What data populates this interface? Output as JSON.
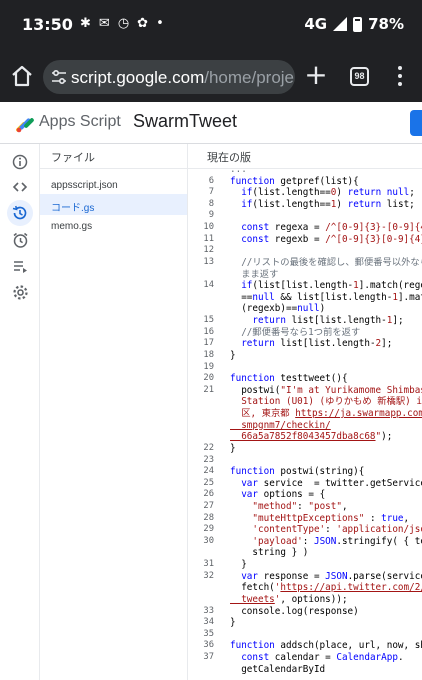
{
  "status_bar": {
    "time": "13:50",
    "network": "4G",
    "battery": "78%"
  },
  "browser": {
    "url_host": "script.google.com",
    "url_path": "/home/proje",
    "tab_count": "98"
  },
  "header": {
    "app_name": "Apps Script",
    "project_name": "SwarmTweet"
  },
  "rail_icons": [
    "info-icon",
    "code-icon",
    "history-icon",
    "clock-icon",
    "executions-icon",
    "settings-icon"
  ],
  "files_panel": {
    "title": "ファイル",
    "files": [
      "appsscript.json",
      "コード.gs",
      "memo.gs"
    ],
    "selected_index": 1
  },
  "editor": {
    "title": "現在の版",
    "lines": [
      {
        "n": "",
        "t": [
          [
            "c",
            "..."
          ]
        ]
      },
      {
        "n": "6",
        "t": [
          [
            "k",
            "function"
          ],
          [
            "v",
            " getpref(list){"
          ]
        ]
      },
      {
        "n": "7",
        "t": [
          [
            "v",
            "  "
          ],
          [
            "k",
            "if"
          ],
          [
            "v",
            "(list.length=="
          ],
          [
            "s",
            "0"
          ],
          [
            "v",
            ") "
          ],
          [
            "k",
            "return"
          ],
          [
            "v",
            " "
          ],
          [
            "k",
            "null"
          ],
          [
            "v",
            ";"
          ]
        ]
      },
      {
        "n": "8",
        "t": [
          [
            "v",
            "  "
          ],
          [
            "k",
            "if"
          ],
          [
            "v",
            "(list.length=="
          ],
          [
            "s",
            "1"
          ],
          [
            "v",
            ") "
          ],
          [
            "k",
            "return"
          ],
          [
            "v",
            " list;"
          ]
        ]
      },
      {
        "n": "9",
        "t": []
      },
      {
        "n": "10",
        "t": [
          [
            "v",
            "  "
          ],
          [
            "k",
            "const"
          ],
          [
            "v",
            " regexa = "
          ],
          [
            "s",
            "/^[0-9]{3}-[0-9]{4}$/"
          ]
        ]
      },
      {
        "n": "11",
        "t": [
          [
            "v",
            "  "
          ],
          [
            "k",
            "const"
          ],
          [
            "v",
            " regexb = "
          ],
          [
            "s",
            "/^[0-9]{3}[0-9]{4}$/;"
          ]
        ]
      },
      {
        "n": "12",
        "t": []
      },
      {
        "n": "13",
        "t": [
          [
            "c",
            "  //リストの最後を確認し、郵便番号以外ならその"
          ]
        ]
      },
      {
        "n": "",
        "t": [
          [
            "c",
            "  まま返す"
          ]
        ]
      },
      {
        "n": "14",
        "t": [
          [
            "v",
            "  "
          ],
          [
            "k",
            "if"
          ],
          [
            "v",
            "(list[list.length-"
          ],
          [
            "s",
            "1"
          ],
          [
            "v",
            "].match(regexa)"
          ]
        ]
      },
      {
        "n": "",
        "t": [
          [
            "v",
            "  =="
          ],
          [
            "k",
            "null"
          ],
          [
            "v",
            " && list[list.length-"
          ],
          [
            "s",
            "1"
          ],
          [
            "v",
            "].match"
          ]
        ]
      },
      {
        "n": "",
        "t": [
          [
            "v",
            "  (regexb)=="
          ],
          [
            "k",
            "null"
          ],
          [
            "v",
            ")"
          ]
        ]
      },
      {
        "n": "15",
        "t": [
          [
            "v",
            "    "
          ],
          [
            "k",
            "return"
          ],
          [
            "v",
            " list[list.length-"
          ],
          [
            "s",
            "1"
          ],
          [
            "v",
            "];"
          ]
        ]
      },
      {
        "n": "16",
        "t": [
          [
            "c",
            "  //郵便番号なら1つ前を返す"
          ]
        ]
      },
      {
        "n": "17",
        "t": [
          [
            "v",
            "  "
          ],
          [
            "k",
            "return"
          ],
          [
            "v",
            " list[list.length-"
          ],
          [
            "s",
            "2"
          ],
          [
            "v",
            "];"
          ]
        ]
      },
      {
        "n": "18",
        "t": [
          [
            "v",
            "}"
          ]
        ]
      },
      {
        "n": "19",
        "t": []
      },
      {
        "n": "20",
        "t": [
          [
            "k",
            "function"
          ],
          [
            "v",
            " testtweet(){"
          ]
        ]
      },
      {
        "n": "21",
        "t": [
          [
            "v",
            "  postwi("
          ],
          [
            "s",
            "\"I'm at Yurikamome Shimbashi"
          ]
        ]
      },
      {
        "n": "",
        "t": [
          [
            "s",
            "  Station (U01) (ゆりかもめ 新橋駅) in 港"
          ]
        ]
      },
      {
        "n": "",
        "t": [
          [
            "s",
            "  区, 東京都 "
          ],
          [
            "u",
            "https://ja.swarmapp.com/"
          ]
        ]
      },
      {
        "n": "",
        "t": [
          [
            "u",
            "  smpgnm7/checkin/"
          ]
        ]
      },
      {
        "n": "",
        "t": [
          [
            "u",
            "  66a5a7852f8043457dba8c68"
          ],
          [
            "s",
            "\""
          ],
          [
            "v",
            ");"
          ]
        ]
      },
      {
        "n": "22",
        "t": [
          [
            "v",
            "}"
          ]
        ]
      },
      {
        "n": "23",
        "t": []
      },
      {
        "n": "24",
        "t": [
          [
            "k",
            "function"
          ],
          [
            "v",
            " postwi(string){"
          ]
        ]
      },
      {
        "n": "25",
        "t": [
          [
            "v",
            "  "
          ],
          [
            "k",
            "var"
          ],
          [
            "v",
            " service  = twitter.getService();"
          ]
        ]
      },
      {
        "n": "26",
        "t": [
          [
            "v",
            "  "
          ],
          [
            "k",
            "var"
          ],
          [
            "v",
            " options = {"
          ]
        ]
      },
      {
        "n": "27",
        "t": [
          [
            "v",
            "    "
          ],
          [
            "s",
            "\"method\""
          ],
          [
            "v",
            ": "
          ],
          [
            "s",
            "\"post\""
          ],
          [
            "v",
            ","
          ]
        ]
      },
      {
        "n": "28",
        "t": [
          [
            "v",
            "    "
          ],
          [
            "s",
            "\"muteHttpExceptions\""
          ],
          [
            "v",
            " : "
          ],
          [
            "k",
            "true"
          ],
          [
            "v",
            ","
          ]
        ]
      },
      {
        "n": "29",
        "t": [
          [
            "v",
            "    "
          ],
          [
            "s",
            "'contentType'"
          ],
          [
            "v",
            ": "
          ],
          [
            "s",
            "'application/json'"
          ],
          [
            "v",
            ","
          ]
        ]
      },
      {
        "n": "30",
        "t": [
          [
            "v",
            "    "
          ],
          [
            "s",
            "'payload'"
          ],
          [
            "v",
            ": "
          ],
          [
            "k",
            "JSON"
          ],
          [
            "v",
            ".stringify( { text:"
          ]
        ]
      },
      {
        "n": "",
        "t": [
          [
            "v",
            "    string } )"
          ]
        ]
      },
      {
        "n": "31",
        "t": [
          [
            "v",
            "  }"
          ]
        ]
      },
      {
        "n": "32",
        "t": [
          [
            "v",
            "  "
          ],
          [
            "k",
            "var"
          ],
          [
            "v",
            " response = "
          ],
          [
            "k",
            "JSON"
          ],
          [
            "v",
            ".parse(service."
          ]
        ]
      },
      {
        "n": "",
        "t": [
          [
            "v",
            "  fetch("
          ],
          [
            "s",
            "'"
          ],
          [
            "u",
            "https://api.twitter.com/2/"
          ]
        ]
      },
      {
        "n": "",
        "t": [
          [
            "u",
            "  tweets"
          ],
          [
            "s",
            "'"
          ],
          [
            "v",
            ", options));"
          ]
        ]
      },
      {
        "n": "33",
        "t": [
          [
            "v",
            "  console.log(response)"
          ]
        ]
      },
      {
        "n": "34",
        "t": [
          [
            "v",
            "}"
          ]
        ]
      },
      {
        "n": "35",
        "t": []
      },
      {
        "n": "36",
        "t": [
          [
            "k",
            "function"
          ],
          [
            "v",
            " addsch(place, url, now, shout"
          ]
        ]
      },
      {
        "n": "37",
        "t": [
          [
            "v",
            "  "
          ],
          [
            "k",
            "const"
          ],
          [
            "v",
            " calendar = "
          ],
          [
            "k",
            "CalendarApp"
          ],
          [
            "v",
            "."
          ]
        ]
      },
      {
        "n": "",
        "t": [
          [
            "v",
            "  getCalendarById"
          ]
        ]
      }
    ]
  }
}
